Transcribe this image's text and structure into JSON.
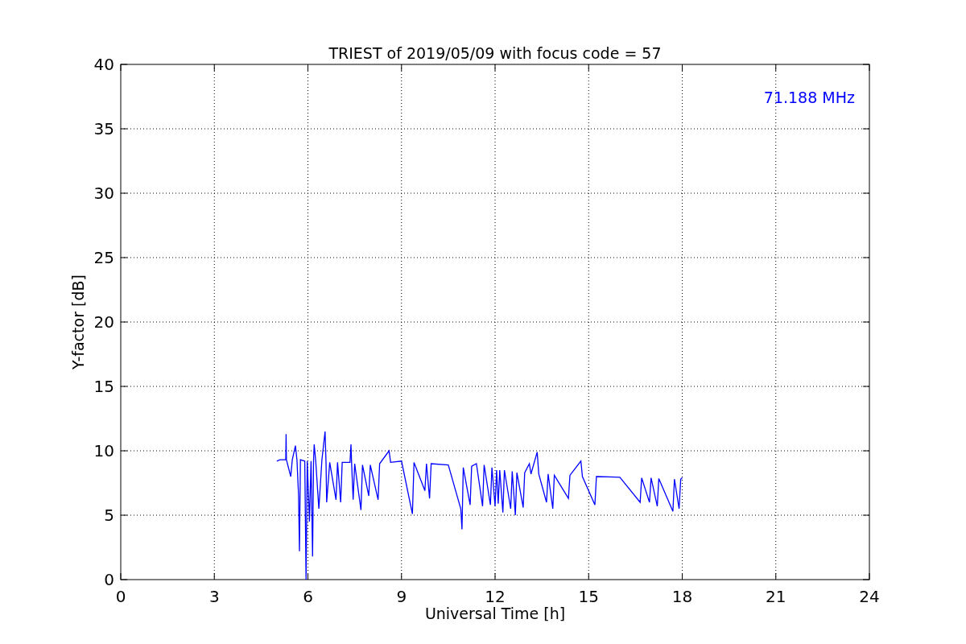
{
  "chart_data": {
    "type": "line",
    "title": "TRIEST of 2019/05/09 with focus code = 57",
    "xlabel": "Universal Time [h]",
    "ylabel": "Y-factor [dB]",
    "xlim": [
      0,
      24
    ],
    "ylim": [
      0,
      40
    ],
    "xticks": [
      0,
      3,
      6,
      9,
      12,
      15,
      18,
      21,
      24
    ],
    "yticks": [
      0,
      5,
      10,
      15,
      20,
      25,
      30,
      35,
      40
    ],
    "x": [
      5.0,
      5.1,
      5.29,
      5.3,
      5.31,
      5.45,
      5.5,
      5.6,
      5.65,
      5.7,
      5.73,
      5.76,
      5.9,
      5.94,
      5.98,
      6.05,
      6.1,
      6.15,
      6.18,
      6.2,
      6.25,
      6.35,
      6.45,
      6.55,
      6.58,
      6.6,
      6.7,
      6.9,
      6.95,
      7.05,
      7.1,
      7.35,
      7.38,
      7.4,
      7.45,
      7.5,
      7.7,
      7.75,
      7.95,
      8.0,
      8.25,
      8.3,
      8.6,
      8.65,
      9.0,
      9.35,
      9.4,
      9.75,
      9.8,
      9.9,
      9.95,
      10.5,
      10.9,
      10.94,
      10.98,
      11.2,
      11.25,
      11.4,
      11.6,
      11.65,
      11.85,
      11.9,
      12.0,
      12.05,
      12.1,
      12.15,
      12.25,
      12.3,
      12.5,
      12.55,
      12.65,
      12.7,
      12.9,
      12.95,
      13.1,
      13.15,
      13.35,
      13.4,
      13.65,
      13.7,
      13.85,
      13.9,
      14.35,
      14.4,
      14.75,
      14.8,
      15.2,
      15.25,
      16.0,
      16.65,
      16.7,
      16.95,
      17.0,
      17.2,
      17.25,
      17.7,
      17.75,
      17.9,
      17.95,
      18.0
    ],
    "series": [
      {
        "name": "71.188 MHz",
        "color": "#0000ff",
        "values": [
          9.2,
          9.3,
          9.3,
          11.3,
          9.3,
          8.0,
          9.3,
          10.4,
          9.3,
          6.5,
          2.2,
          9.3,
          9.2,
          0,
          9.2,
          4.5,
          9.2,
          1.8,
          9.2,
          10.5,
          9.2,
          5.5,
          9.3,
          11.5,
          9.1,
          6.0,
          9.1,
          6.2,
          9.1,
          6.0,
          9.1,
          9.1,
          10.5,
          9.0,
          6.2,
          9.0,
          5.4,
          8.9,
          6.5,
          8.9,
          6.2,
          9.0,
          10.0,
          9.1,
          9.2,
          5.1,
          9.1,
          6.9,
          9.0,
          6.3,
          9.0,
          8.9,
          5.5,
          3.9,
          8.7,
          5.8,
          8.8,
          9.0,
          5.7,
          8.9,
          5.8,
          8.7,
          5.7,
          8.5,
          5.9,
          8.5,
          5.2,
          8.5,
          5.5,
          8.4,
          5.0,
          8.3,
          5.6,
          8.3,
          9.0,
          8.2,
          9.9,
          8.2,
          6.0,
          8.2,
          5.5,
          8.1,
          6.3,
          8.1,
          9.2,
          8.0,
          5.8,
          8.0,
          7.95,
          6.0,
          7.9,
          6.0,
          7.9,
          5.7,
          7.85,
          5.3,
          7.8,
          5.5,
          7.8,
          7.9
        ]
      }
    ],
    "grid": true
  }
}
